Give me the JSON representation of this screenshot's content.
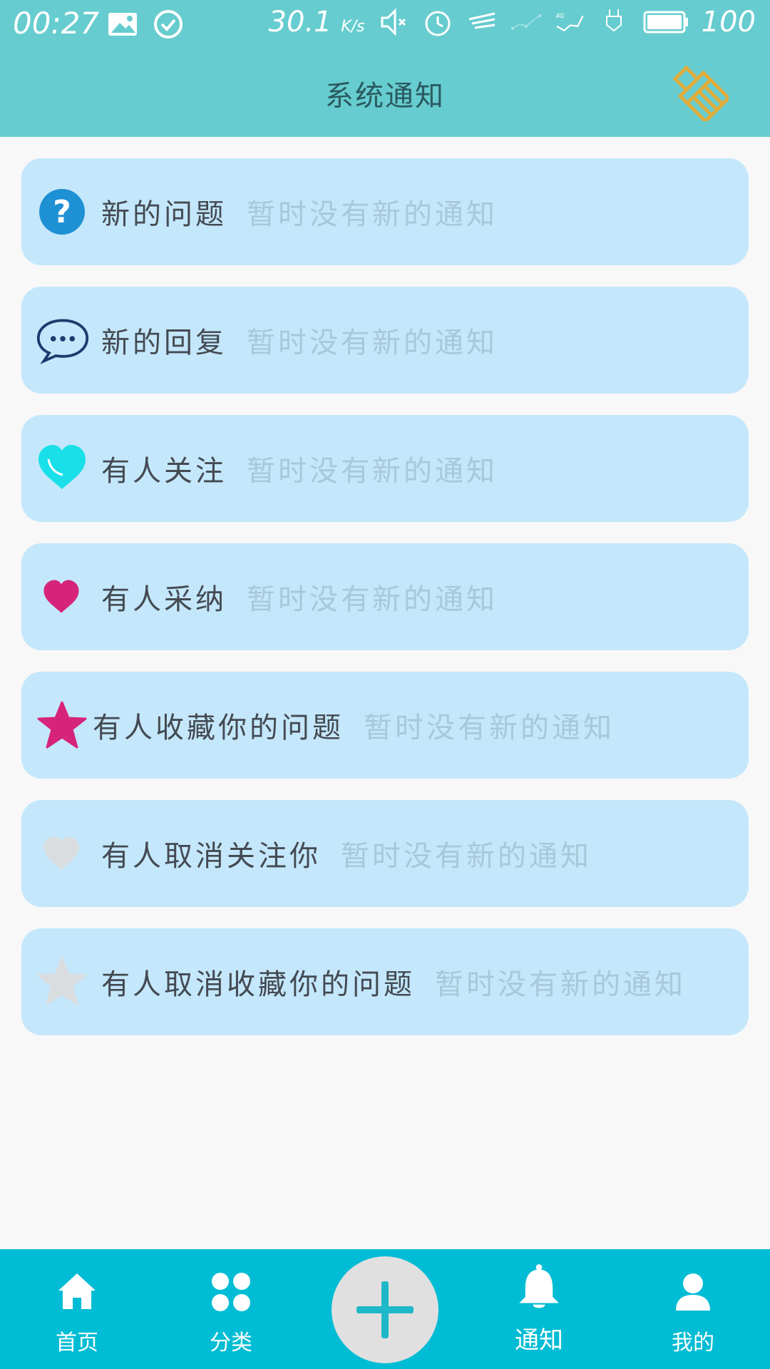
{
  "status_bar": {
    "time": "00:27",
    "speed": "30.1",
    "speed_unit": "K/s",
    "network": "4G",
    "battery": "100"
  },
  "header": {
    "title": "系统通知",
    "clear_icon": "broom-icon"
  },
  "notifications": [
    {
      "title": "新的问题",
      "status": "暂时没有新的通知",
      "icon": "question-icon"
    },
    {
      "title": "新的回复",
      "status": "暂时没有新的通知",
      "icon": "chat-bubble-icon"
    },
    {
      "title": "有人关注",
      "status": "暂时没有新的通知",
      "icon": "heart-cyan-icon"
    },
    {
      "title": "有人采纳",
      "status": "暂时没有新的通知",
      "icon": "heart-pink-icon"
    },
    {
      "title": "有人收藏你的问题",
      "status": "暂时没有新的通知",
      "icon": "star-pink-icon"
    },
    {
      "title": "有人取消关注你",
      "status": "暂时没有新的通知",
      "icon": "heart-gray-icon"
    },
    {
      "title": "有人取消收藏你的问题",
      "status": "暂时没有新的通知",
      "icon": "star-gray-icon"
    }
  ],
  "bottom_nav": {
    "home": "首页",
    "category": "分类",
    "add": "add-icon",
    "notify": "通知",
    "mine": "我的"
  },
  "colors": {
    "header": "#66cccf",
    "card": "#c4e7fb",
    "nav": "#00bcd4"
  }
}
